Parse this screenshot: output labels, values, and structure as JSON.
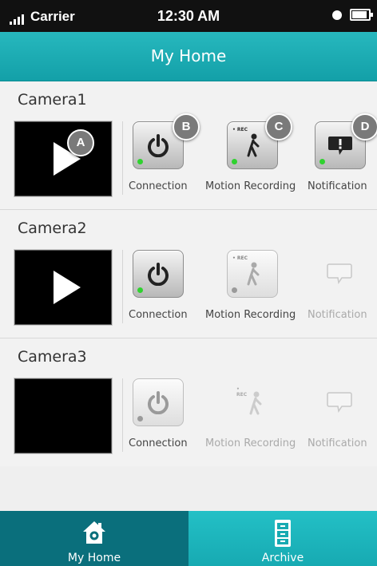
{
  "status_bar": {
    "carrier": "Carrier",
    "time": "12:30 AM"
  },
  "header": {
    "title": "My Home"
  },
  "cameras": [
    {
      "name": "Camera1",
      "actions": [
        {
          "label": "Connection",
          "badge": "A"
        },
        {
          "label": "Connection",
          "badge": "B"
        },
        {
          "label": "Motion Recording",
          "badge": "C"
        },
        {
          "label": "Notification",
          "badge": "D"
        }
      ]
    },
    {
      "name": "Camera2",
      "actions": [
        {
          "label": "Connection"
        },
        {
          "label": "Motion Recording"
        },
        {
          "label": "Notification"
        }
      ]
    },
    {
      "name": "Camera3",
      "actions": [
        {
          "label": "Connection"
        },
        {
          "label": "Motion Recording"
        },
        {
          "label": "Notification"
        }
      ]
    }
  ],
  "rec_tag": "• REC",
  "tabs": [
    {
      "label": "My Home",
      "icon": "home-icon",
      "active": true
    },
    {
      "label": "Archive",
      "icon": "archive-icon",
      "active": false
    }
  ],
  "colors": {
    "accent": "#1aa9b0",
    "tab_active": "#0a6f7c",
    "status_on": "#2fd22f"
  }
}
